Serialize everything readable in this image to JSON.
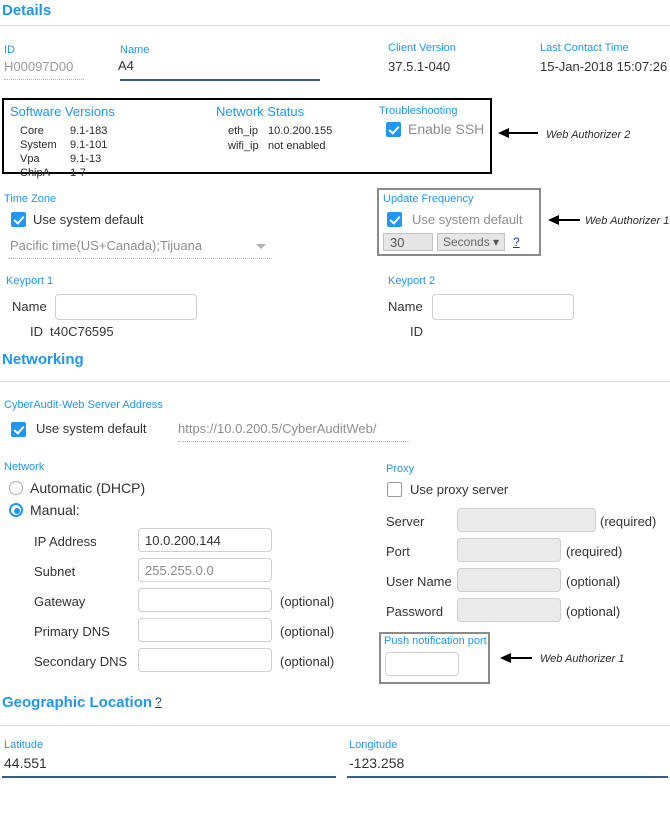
{
  "sections": {
    "details": {
      "title": "Details"
    },
    "networking": {
      "title": "Networking"
    },
    "geo": {
      "title": "Geographic Location",
      "help": "?"
    }
  },
  "details": {
    "id_label": "ID",
    "id_value": "H00097D00",
    "name_label": "Name",
    "name_value": "A4",
    "client_version_label": "Client Version",
    "client_version_value": "37.5.1-040",
    "last_contact_label": "Last Contact Time",
    "last_contact_value": "15-Jan-2018 15:07:26"
  },
  "software_versions": {
    "title": "Software Versions",
    "rows": [
      {
        "name": "Core",
        "value": "9.1-183"
      },
      {
        "name": "System",
        "value": "9.1-101"
      },
      {
        "name": "Vpa",
        "value": "9.1-13"
      },
      {
        "name": "ChipA",
        "value": "1-7"
      }
    ]
  },
  "network_status": {
    "title": "Network Status",
    "rows": [
      {
        "name": "eth_ip",
        "value": "10.0.200.155"
      },
      {
        "name": "wifi_ip",
        "value": "not enabled"
      }
    ]
  },
  "troubleshooting": {
    "title": "Troubleshooting",
    "enable_ssh_label": "Enable SSH",
    "enable_ssh_checked": true
  },
  "annotations": {
    "web_authorizer_2": "Web Authorizer 2",
    "web_authorizer_1_update": "Web Authorizer 1",
    "web_authorizer_1_push": "Web Authorizer 1"
  },
  "time_zone": {
    "label": "Time Zone",
    "use_default_label": "Use system default",
    "use_default_checked": true,
    "selected": "Pacific time(US+Canada);Tijuana"
  },
  "update_frequency": {
    "label": "Update Frequency",
    "use_default_label": "Use system default",
    "use_default_checked": true,
    "interval_value": "30",
    "unit_value": "Seconds",
    "help": "?"
  },
  "keyport1": {
    "title": "Keyport 1",
    "name_label": "Name",
    "name_value": "",
    "id_label": "ID",
    "id_value": "t40C76595"
  },
  "keyport2": {
    "title": "Keyport 2",
    "name_label": "Name",
    "name_value": "",
    "id_label": "ID",
    "id_value": ""
  },
  "cyberaudit": {
    "label": "CyberAudit-Web Server Address",
    "use_default_label": "Use system default",
    "use_default_checked": true,
    "address": "https://10.0.200.5/CyberAuditWeb/"
  },
  "network": {
    "label": "Network",
    "automatic_label": "Automatic (DHCP)",
    "manual_label": "Manual:",
    "mode": "manual",
    "fields": [
      {
        "label": "IP Address",
        "value": "10.0.200.144",
        "note": ""
      },
      {
        "label": "Subnet",
        "value": "255.255.0.0",
        "note": ""
      },
      {
        "label": "Gateway",
        "value": "",
        "note": "(optional)"
      },
      {
        "label": "Primary DNS",
        "value": "",
        "note": "(optional)"
      },
      {
        "label": "Secondary DNS",
        "value": "",
        "note": "(optional)"
      }
    ]
  },
  "proxy": {
    "label": "Proxy",
    "use_proxy_label": "Use proxy server",
    "use_proxy_checked": false,
    "fields": [
      {
        "label": "Server",
        "value": "",
        "note": "(required)"
      },
      {
        "label": "Port",
        "value": "",
        "note": "(required)"
      },
      {
        "label": "User Name",
        "value": "",
        "note": "(optional)"
      },
      {
        "label": "Password",
        "value": "",
        "note": "(optional)"
      }
    ]
  },
  "push_notification": {
    "label": "Push notification port",
    "value": ""
  },
  "geo": {
    "latitude_label": "Latitude",
    "latitude_value": "44.551",
    "longitude_label": "Longitude",
    "longitude_value": "-123.258"
  }
}
